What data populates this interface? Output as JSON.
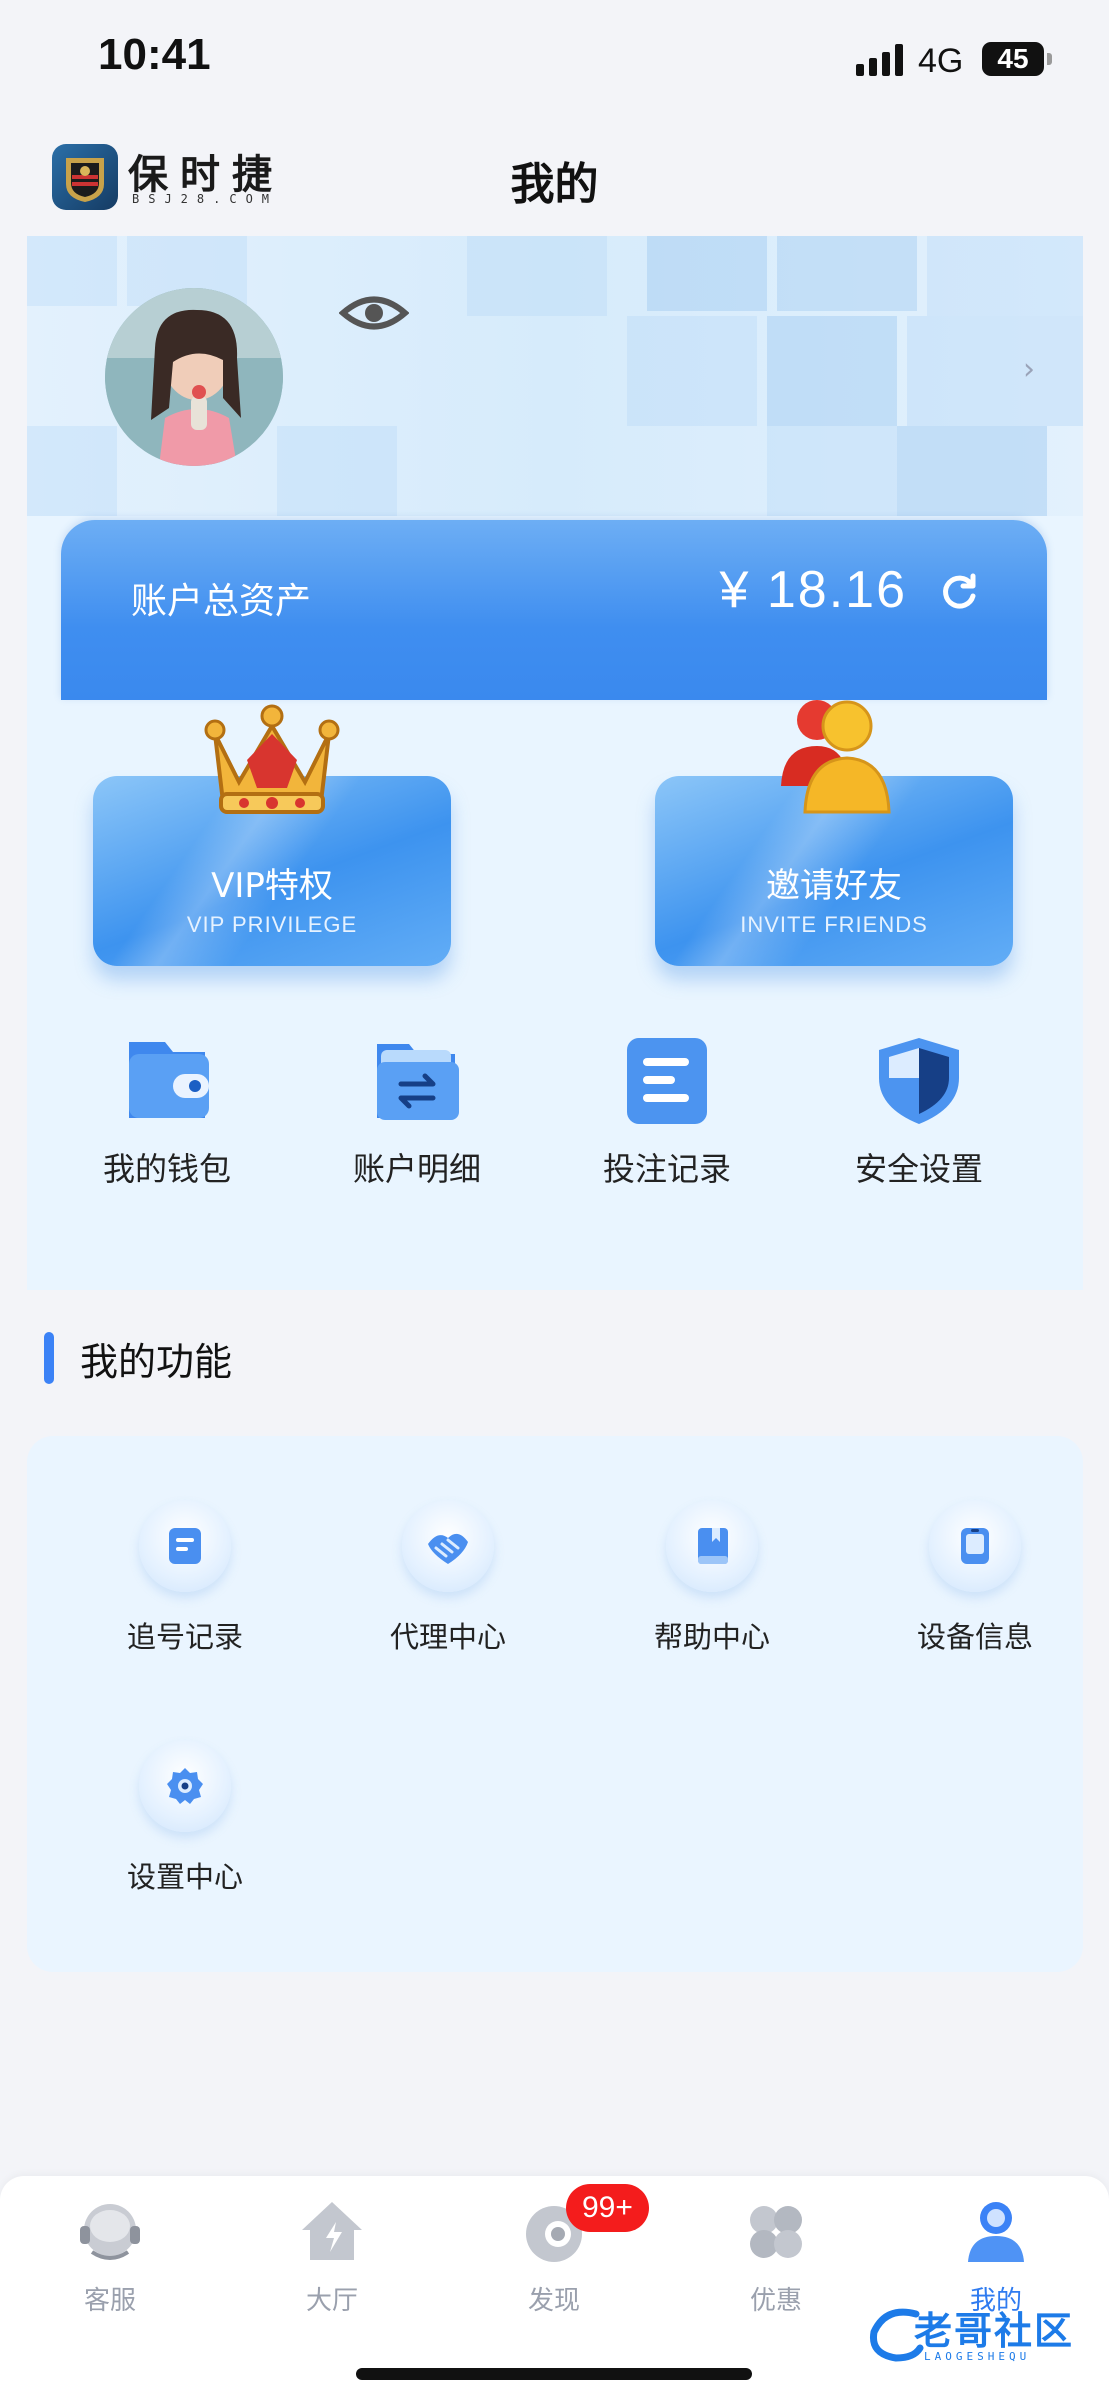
{
  "status_bar": {
    "time": "10:41",
    "network": "4G",
    "battery": "45"
  },
  "header": {
    "brand_name": "保时捷",
    "brand_sub": "BSJ28.COM",
    "title": "我的"
  },
  "account": {
    "assets_label": "账户总资产",
    "assets_value": "¥ 18.16"
  },
  "promos": [
    {
      "title": "VIP特权",
      "subtitle": "VIP PRIVILEGE",
      "icon": "crown-icon"
    },
    {
      "title": "邀请好友",
      "subtitle": "INVITE FRIENDS",
      "icon": "friends-icon"
    }
  ],
  "quick_actions": [
    {
      "label": "我的钱包",
      "icon": "wallet-icon"
    },
    {
      "label": "账户明细",
      "icon": "folder-transfer-icon"
    },
    {
      "label": "投注记录",
      "icon": "document-list-icon"
    },
    {
      "label": "安全设置",
      "icon": "shield-icon"
    }
  ],
  "functions_section": {
    "title": "我的功能"
  },
  "functions": [
    {
      "label": "追号记录",
      "icon": "record-icon"
    },
    {
      "label": "代理中心",
      "icon": "handshake-icon"
    },
    {
      "label": "帮助中心",
      "icon": "book-icon"
    },
    {
      "label": "设备信息",
      "icon": "tablet-icon"
    },
    {
      "label": "设置中心",
      "icon": "gear-icon"
    }
  ],
  "tab_bar": {
    "tabs": [
      {
        "label": "客服",
        "icon": "support-icon"
      },
      {
        "label": "大厅",
        "icon": "home-icon"
      },
      {
        "label": "发现",
        "icon": "discover-icon"
      },
      {
        "label": "优惠",
        "icon": "clover-icon"
      },
      {
        "label": "我的",
        "icon": "profile-icon",
        "active": true
      }
    ],
    "badge": "99+"
  },
  "watermark": {
    "text": "老哥社区",
    "sub": "LAOGESHEQU"
  },
  "colors": {
    "accent": "#3b82f6",
    "card_bg": "#e9f5ff",
    "badge": "#f41c1c"
  }
}
